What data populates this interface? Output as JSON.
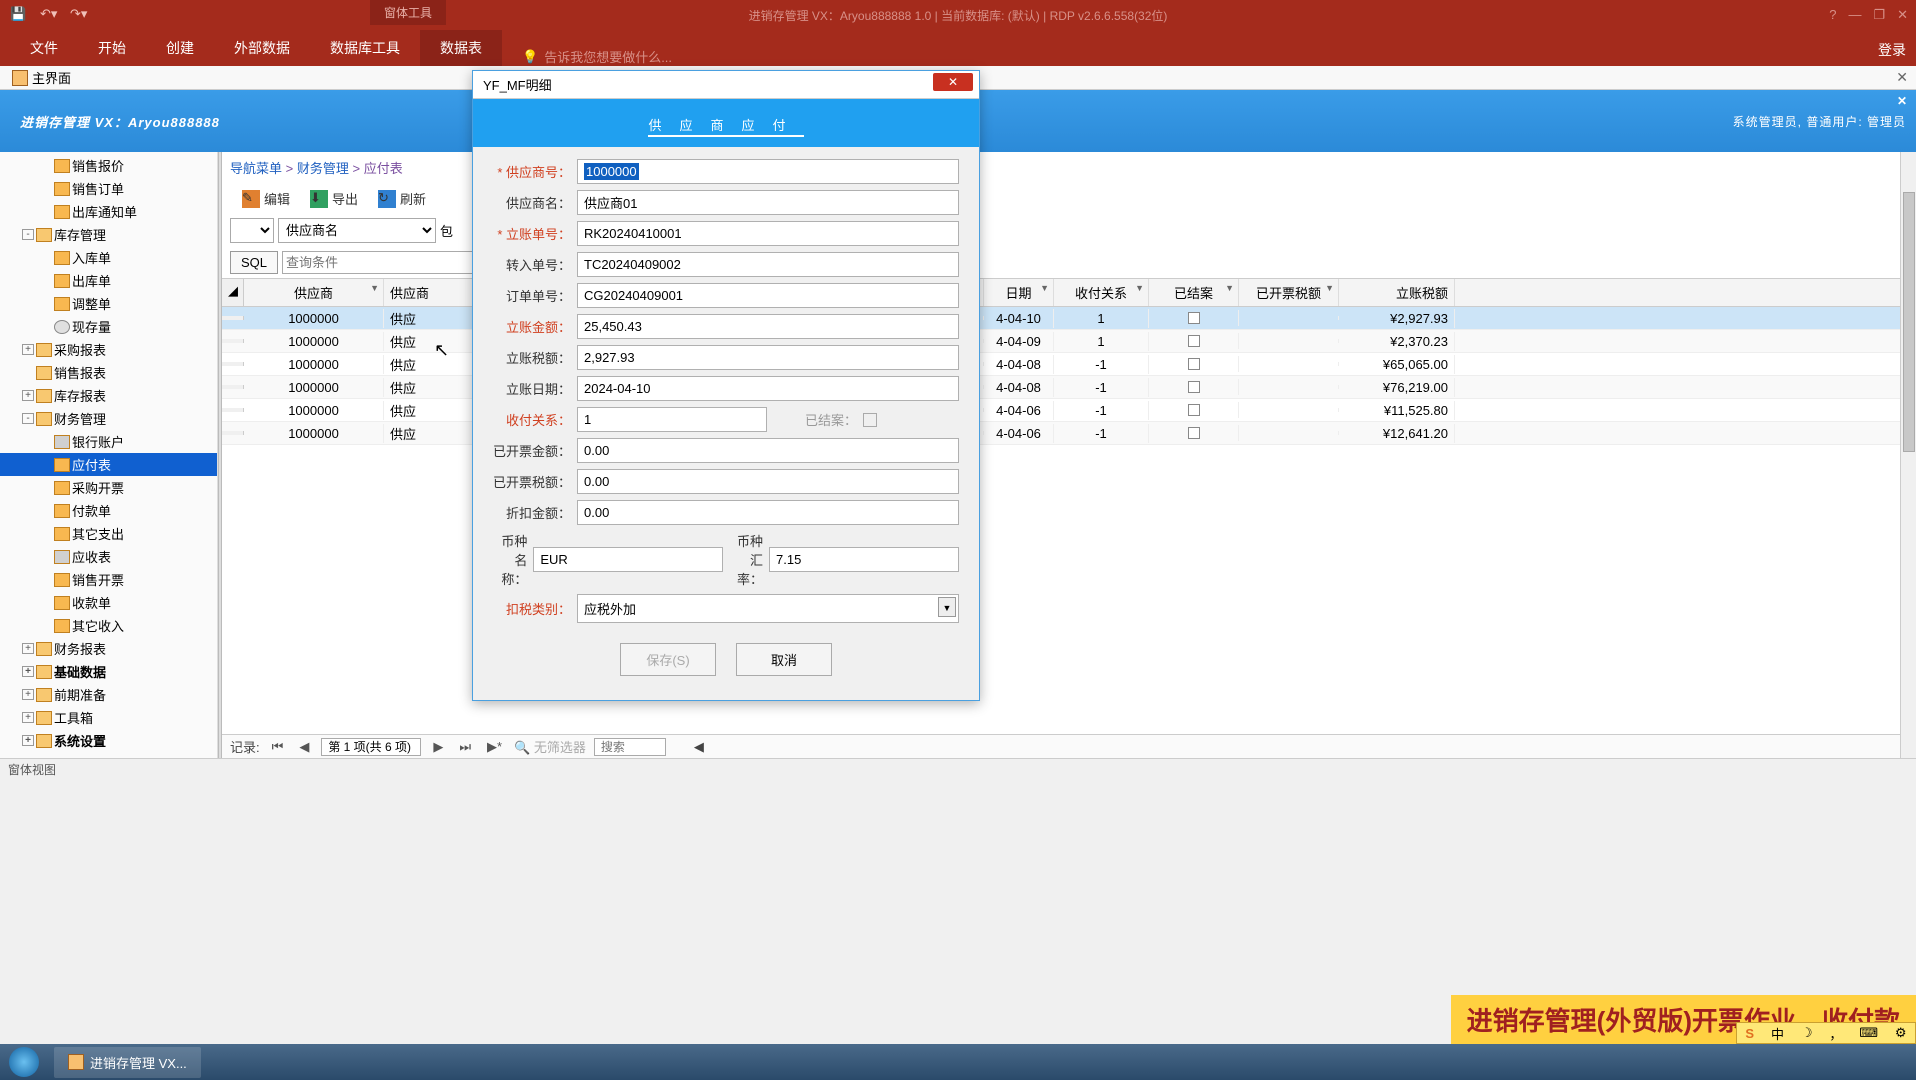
{
  "title_bar": {
    "title": "进销存管理  VX：Aryou888888 1.0 | 当前数据库: (默认) | RDP v2.6.6.558(32位)",
    "tool_label": "窗体工具"
  },
  "ribbon": {
    "tabs": [
      "文件",
      "开始",
      "创建",
      "外部数据",
      "数据库工具",
      "数据表"
    ],
    "active": 5,
    "tell_me": "告诉我您想要做什么...",
    "login": "登录"
  },
  "doc_tab": {
    "label": "主界面"
  },
  "header": {
    "title": "进销存管理  VX：Aryou888888",
    "user_info": "系统管理员, 普通用户: 管理员"
  },
  "tree": [
    {
      "level": 3,
      "icon": "doc",
      "label": "销售报价"
    },
    {
      "level": 3,
      "icon": "doc",
      "label": "销售订单"
    },
    {
      "level": 3,
      "icon": "doc",
      "label": "出库通知单"
    },
    {
      "level": 2,
      "toggle": "-",
      "icon": "folder",
      "label": "库存管理"
    },
    {
      "level": 3,
      "icon": "doc",
      "label": "入库单"
    },
    {
      "level": 3,
      "icon": "doc",
      "label": "出库单"
    },
    {
      "level": 3,
      "icon": "doc",
      "label": "调整单"
    },
    {
      "level": 3,
      "icon": "magnify",
      "label": "现存量"
    },
    {
      "level": 2,
      "toggle": "+",
      "icon": "folder",
      "label": "采购报表"
    },
    {
      "level": 2,
      "icon": "folder",
      "label": "销售报表"
    },
    {
      "level": 2,
      "toggle": "+",
      "icon": "folder",
      "label": "库存报表"
    },
    {
      "level": 2,
      "toggle": "-",
      "icon": "folder",
      "label": "财务管理"
    },
    {
      "level": 3,
      "icon": "bank",
      "label": "银行账户"
    },
    {
      "level": 3,
      "icon": "doc",
      "label": "应付表",
      "selected": true
    },
    {
      "level": 3,
      "icon": "doc",
      "label": "采购开票"
    },
    {
      "level": 3,
      "icon": "doc",
      "label": "付款单"
    },
    {
      "level": 3,
      "icon": "doc",
      "label": "其它支出"
    },
    {
      "level": 3,
      "icon": "bank",
      "label": "应收表"
    },
    {
      "level": 3,
      "icon": "doc",
      "label": "销售开票"
    },
    {
      "level": 3,
      "icon": "doc",
      "label": "收款单"
    },
    {
      "level": 3,
      "icon": "doc",
      "label": "其它收入"
    },
    {
      "level": 2,
      "toggle": "+",
      "icon": "folder",
      "label": "财务报表"
    },
    {
      "level": 2,
      "toggle": "+",
      "icon": "folder",
      "label": "基础数据",
      "bold": true
    },
    {
      "level": 2,
      "toggle": "+",
      "icon": "folder",
      "label": "前期准备"
    },
    {
      "level": 2,
      "toggle": "+",
      "icon": "folder",
      "label": "工具箱"
    },
    {
      "level": 2,
      "toggle": "+",
      "icon": "folder",
      "label": "系统设置",
      "bold": true
    }
  ],
  "breadcrumb": {
    "nav": "导航菜单",
    "sep": " > ",
    "fin": "财务管理",
    "page": "应付表"
  },
  "toolbar": {
    "edit": "编辑",
    "export": "导出",
    "refresh": "刷新"
  },
  "filter": {
    "supplier_name": "供应商名",
    "contains": "包",
    "sql": "SQL",
    "query": "查询条件"
  },
  "grid": {
    "columns": [
      "供应商",
      "供应商",
      "日期",
      "收付关系",
      "已结案",
      "已开票税额",
      "立账税额"
    ],
    "rows": [
      {
        "supplier": "1000000",
        "name": "供应",
        "date": "4-04-10",
        "rel": "1",
        "closed": false,
        "tax_inv": "",
        "amount": "¥2,927.93",
        "selected": true
      },
      {
        "supplier": "1000000",
        "name": "供应",
        "date": "4-04-09",
        "rel": "1",
        "closed": false,
        "tax_inv": "",
        "amount": "¥2,370.23"
      },
      {
        "supplier": "1000000",
        "name": "供应",
        "date": "4-04-08",
        "rel": "-1",
        "closed": false,
        "tax_inv": "",
        "amount": "¥65,065.00"
      },
      {
        "supplier": "1000000",
        "name": "供应",
        "date": "4-04-08",
        "rel": "-1",
        "closed": false,
        "tax_inv": "",
        "amount": "¥76,219.00"
      },
      {
        "supplier": "1000000",
        "name": "供应",
        "date": "4-04-06",
        "rel": "-1",
        "closed": false,
        "tax_inv": "",
        "amount": "¥11,525.80"
      },
      {
        "supplier": "1000000",
        "name": "供应",
        "date": "4-04-06",
        "rel": "-1",
        "closed": false,
        "tax_inv": "",
        "amount": "¥12,641.20"
      }
    ]
  },
  "navigator": {
    "label": "记录:",
    "pos": "第 1 项(共 6 项)",
    "no_filter": "无筛选器",
    "search": "搜索"
  },
  "status_bar": "窗体视图",
  "taskbar": {
    "app": "进销存管理  VX..."
  },
  "overlay": "进销存管理(外贸版)开票作业、收付款",
  "dialog": {
    "title": "YF_MF明细",
    "header": "供应商应付",
    "fields": {
      "supplier_no_label": "* 供应商号：",
      "supplier_no": "1000000",
      "supplier_name_label": "供应商名：",
      "supplier_name": "供应商01",
      "doc_no_label": "* 立账单号：",
      "doc_no": "RK20240410001",
      "transfer_no_label": "转入单号：",
      "transfer_no": "TC20240409002",
      "order_no_label": "订单单号：",
      "order_no": "CG20240409001",
      "amount_label": "立账金额：",
      "amount": "25,450.43",
      "tax_label": "立账税额：",
      "tax": "2,927.93",
      "date_label": "立账日期：",
      "date": "2024-04-10",
      "rel_label": "收付关系：",
      "rel": "1",
      "closed_label": "已结案：",
      "invoiced_amt_label": "已开票金额：",
      "invoiced_amt": "0.00",
      "invoiced_tax_label": "已开票税额：",
      "invoiced_tax": "0.00",
      "discount_label": "折扣金额：",
      "discount": "0.00",
      "currency_label": "币种名称：",
      "currency": "EUR",
      "rate_label": "币种汇率：",
      "rate": "7.15",
      "tax_type_label": "扣税类别：",
      "tax_type": "应税外加"
    },
    "buttons": {
      "save": "保存(S)",
      "cancel": "取消"
    }
  }
}
